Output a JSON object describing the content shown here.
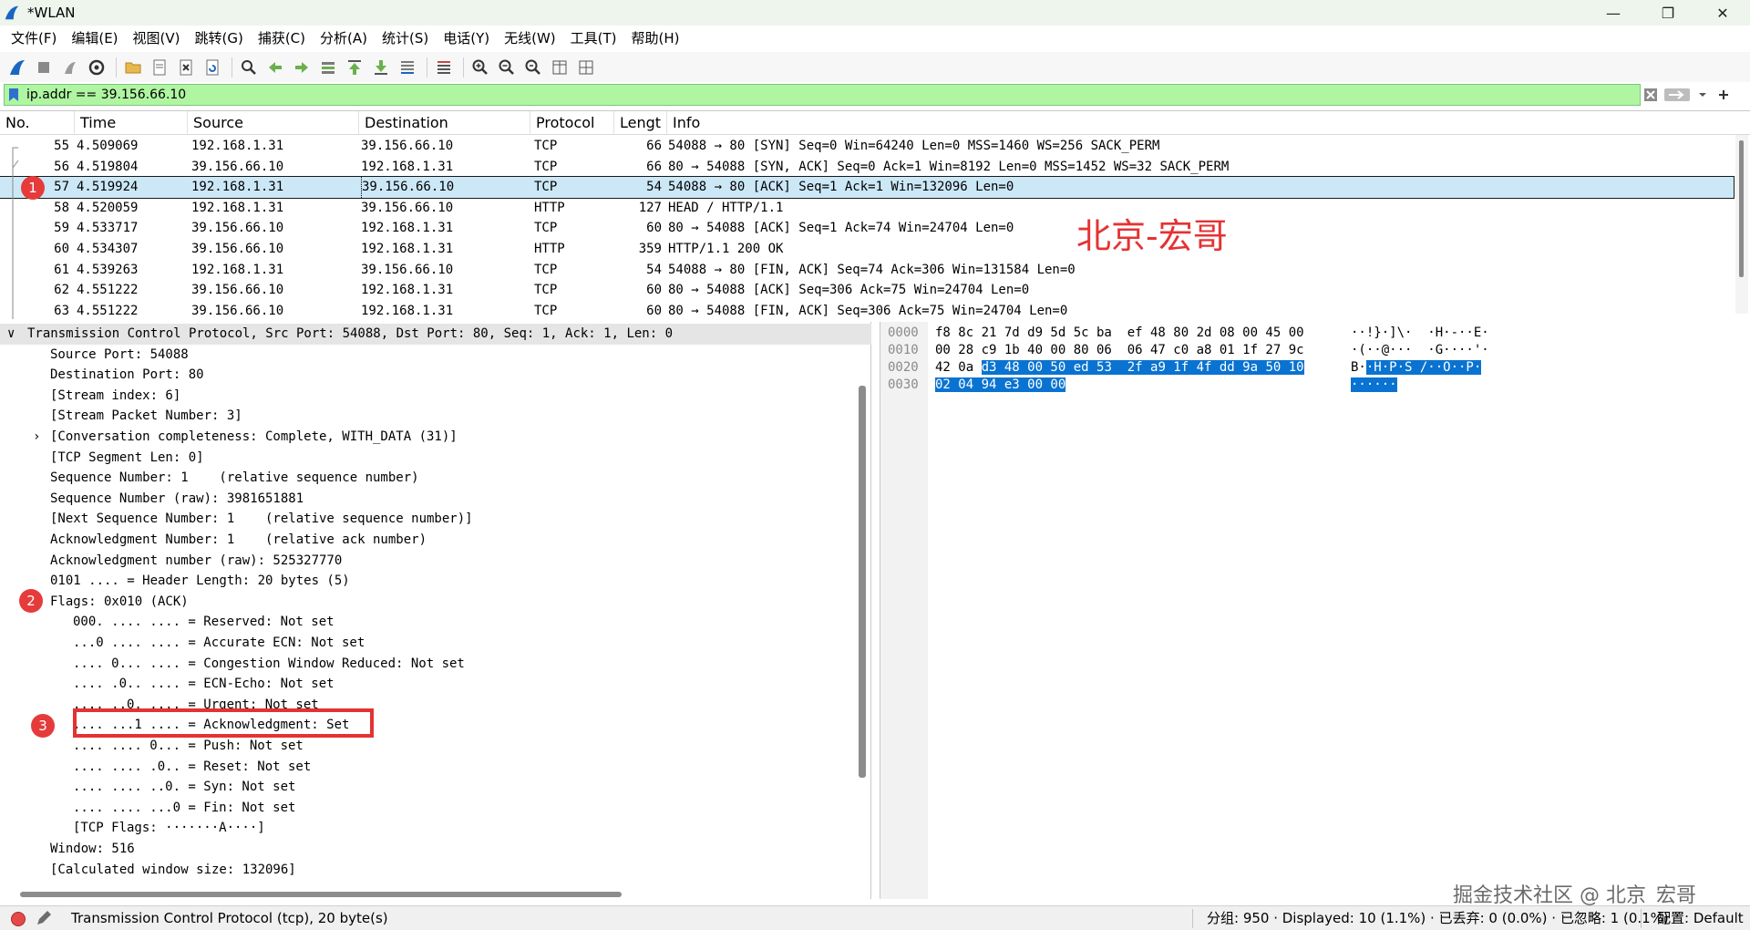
{
  "window": {
    "title": "*WLAN",
    "minimize_glyph": "—",
    "maximize_glyph": "❐",
    "close_glyph": "✕"
  },
  "menu": [
    "文件(F)",
    "编辑(E)",
    "视图(V)",
    "跳转(G)",
    "捕获(C)",
    "分析(A)",
    "统计(S)",
    "电话(Y)",
    "无线(W)",
    "工具(T)",
    "帮助(H)"
  ],
  "filter": {
    "value": "ip.addr == 39.156.66.10"
  },
  "packet_list": {
    "columns": [
      "No.",
      "Time",
      "Source",
      "Destination",
      "Protocol",
      "Lengt",
      "Info"
    ],
    "rows": [
      {
        "no": "55",
        "time": "4.509069",
        "src": "192.168.1.31",
        "dst": "39.156.66.10",
        "proto": "TCP",
        "len": "66",
        "info": "54088 → 80 [SYN] Seq=0 Win=64240 Len=0 MSS=1460 WS=256 SACK_PERM"
      },
      {
        "no": "56",
        "time": "4.519804",
        "src": "39.156.66.10",
        "dst": "192.168.1.31",
        "proto": "TCP",
        "len": "66",
        "info": "80 → 54088 [SYN, ACK] Seq=0 Ack=1 Win=8192 Len=0 MSS=1452 WS=32 SACK_PERM"
      },
      {
        "no": "57",
        "time": "4.519924",
        "src": "192.168.1.31",
        "dst": "39.156.66.10",
        "proto": "TCP",
        "len": "54",
        "info": "54088 → 80 [ACK] Seq=1 Ack=1 Win=132096 Len=0"
      },
      {
        "no": "58",
        "time": "4.520059",
        "src": "192.168.1.31",
        "dst": "39.156.66.10",
        "proto": "HTTP",
        "len": "127",
        "info": "HEAD / HTTP/1.1"
      },
      {
        "no": "59",
        "time": "4.533717",
        "src": "39.156.66.10",
        "dst": "192.168.1.31",
        "proto": "TCP",
        "len": "60",
        "info": "80 → 54088 [ACK] Seq=1 Ack=74 Win=24704 Len=0"
      },
      {
        "no": "60",
        "time": "4.534307",
        "src": "39.156.66.10",
        "dst": "192.168.1.31",
        "proto": "HTTP",
        "len": "359",
        "info": "HTTP/1.1 200 OK"
      },
      {
        "no": "61",
        "time": "4.539263",
        "src": "192.168.1.31",
        "dst": "39.156.66.10",
        "proto": "TCP",
        "len": "54",
        "info": "54088 → 80 [FIN, ACK] Seq=74 Ack=306 Win=131584 Len=0"
      },
      {
        "no": "62",
        "time": "4.551222",
        "src": "39.156.66.10",
        "dst": "192.168.1.31",
        "proto": "TCP",
        "len": "60",
        "info": "80 → 54088 [ACK] Seq=306 Ack=75 Win=24704 Len=0"
      },
      {
        "no": "63",
        "time": "4.551222",
        "src": "39.156.66.10",
        "dst": "192.168.1.31",
        "proto": "TCP",
        "len": "60",
        "info": "80 → 54088 [FIN, ACK] Seq=306 Ack=75 Win=24704 Len=0"
      }
    ],
    "selected_no": "57"
  },
  "annotations": {
    "marker1": "1",
    "marker2": "2",
    "marker3": "3",
    "watermark_top": "北京-宏哥",
    "watermark_bottom": "掘金技术社区 @ 北京_宏哥"
  },
  "details": {
    "header": "Transmission Control Protocol, Src Port: 54088, Dst Port: 80, Seq: 1, Ack: 1, Len: 0",
    "lines": [
      "Source Port: 54088",
      "Destination Port: 80",
      "[Stream index: 6]",
      "[Stream Packet Number: 3]",
      "[Conversation completeness: Complete, WITH_DATA (31)]",
      "[TCP Segment Len: 0]",
      "Sequence Number: 1    (relative sequence number)",
      "Sequence Number (raw): 3981651881",
      "[Next Sequence Number: 1    (relative sequence number)]",
      "Acknowledgment Number: 1    (relative ack number)",
      "Acknowledgment number (raw): 525327770",
      "0101 .... = Header Length: 20 bytes (5)",
      "Flags: 0x010 (ACK)"
    ],
    "flag_lines": [
      "000. .... .... = Reserved: Not set",
      "...0 .... .... = Accurate ECN: Not set",
      ".... 0... .... = Congestion Window Reduced: Not set",
      ".... .0.. .... = ECN-Echo: Not set",
      ".... ..0. .... = Urgent: Not set",
      ".... ...1 .... = Acknowledgment: Set",
      ".... .... 0... = Push: Not set",
      ".... .... .0.. = Reset: Not set",
      ".... .... ..0. = Syn: Not set",
      ".... .... ...0 = Fin: Not set",
      "[TCP Flags: ·······A····]"
    ],
    "tail_lines": [
      "Window: 516",
      "[Calculated window size: 132096]"
    ]
  },
  "bytes": {
    "rows": [
      {
        "offset": "0000",
        "hex_plain": "f8 8c 21 7d d9 5d 5c ba  ef 48 80 2d 08 00 45 00",
        "hex_hl": "",
        "ascii_plain": "··!}·]\\·  ·H·-··E·",
        "ascii_hl": ""
      },
      {
        "offset": "0010",
        "hex_plain": "00 28 c9 1b 40 00 80 06  06 47 c0 a8 01 1f 27 9c",
        "hex_hl": "",
        "ascii_plain": "·(··@···  ·G····'·",
        "ascii_hl": ""
      },
      {
        "offset": "0020",
        "hex_plain": "42 0a ",
        "hex_hl": "d3 48 00 50 ed 53  2f a9 1f 4f dd 9a 50 10",
        "ascii_plain": "B·",
        "ascii_hl": "·H·P·S /··O··P·"
      },
      {
        "offset": "0030",
        "hex_plain": "",
        "hex_hl": "02 04 94 e3 00 00",
        "ascii_plain": "",
        "ascii_hl": "······"
      }
    ]
  },
  "status": {
    "protocol_text": "Transmission Control Protocol (tcp), 20 byte(s)",
    "stats": "分组: 950 · Displayed: 10 (1.1%) · 已丢弃: 0 (0.0%) · 已忽略: 1 (0.1%)",
    "profile": "配置: Default"
  },
  "colors": {
    "filter_bg": "#aff5a2",
    "selected_row": "#cce8f7",
    "marker": "#e53b3b",
    "byte_highlight": "#0a73d1"
  }
}
